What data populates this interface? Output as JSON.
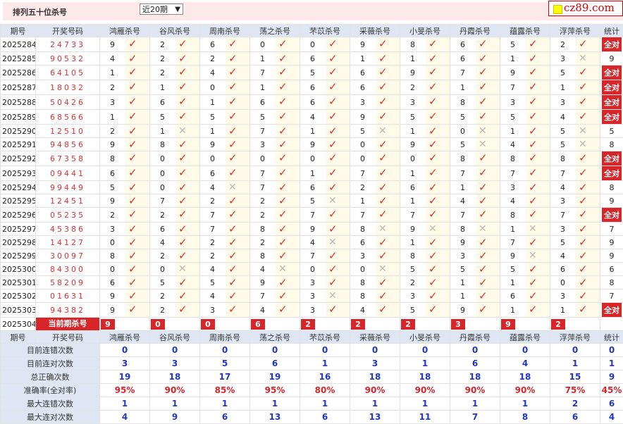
{
  "header": {
    "title": "排列五十位杀号",
    "period_select": "近20期",
    "logo_text": "cz89.com"
  },
  "columns": [
    "期号",
    "开奖号码",
    "鸿雁杀号",
    "谷风杀号",
    "周南杀号",
    "荡之杀号",
    "芣苡杀号",
    "采薇杀号",
    "小旻杀号",
    "丹霞杀号",
    "蕴露杀号",
    "浮萍杀号",
    "统计"
  ],
  "rows": [
    {
      "issue": "2025284",
      "num": "24733",
      "k": [
        "9",
        "2",
        "6",
        "0",
        "0",
        "9",
        "8",
        "6",
        "5",
        "2"
      ],
      "s": "全对"
    },
    {
      "issue": "2025285",
      "num": "90532",
      "k": [
        "4",
        "2",
        "2",
        "1",
        "6",
        "1",
        "1",
        "6",
        "1",
        "3"
      ],
      "s": "9"
    },
    {
      "issue": "2025286",
      "num": "64105",
      "k": [
        "1",
        "2",
        "4",
        "7",
        "5",
        "6",
        "9",
        "7",
        "9",
        "5"
      ],
      "s": "全对"
    },
    {
      "issue": "2025287",
      "num": "18032",
      "k": [
        "2",
        "1",
        "0",
        "1",
        "6",
        "6",
        "2",
        "1",
        "7",
        "1"
      ],
      "s": "全对"
    },
    {
      "issue": "2025288",
      "num": "50426",
      "k": [
        "3",
        "6",
        "1",
        "6",
        "6",
        "3",
        "3",
        "8",
        "3",
        "3"
      ],
      "s": "全对"
    },
    {
      "issue": "2025289",
      "num": "68566",
      "k": [
        "1",
        "5",
        "5",
        "5",
        "4",
        "9",
        "5",
        "5",
        "5",
        "4"
      ],
      "s": "全对"
    },
    {
      "issue": "2025290",
      "num": "12510",
      "k": [
        "2",
        "1",
        "1",
        "7",
        "1",
        "5",
        "1",
        "0",
        "1",
        "5"
      ],
      "s": "5"
    },
    {
      "issue": "2025291",
      "num": "94856",
      "k": [
        "9",
        "8",
        "9",
        "3",
        "9",
        "0",
        "9",
        "5",
        "4",
        "5"
      ],
      "s": "8"
    },
    {
      "issue": "2025292",
      "num": "67358",
      "k": [
        "8",
        "0",
        "0",
        "0",
        "0",
        "0",
        "0",
        "8",
        "8",
        "8"
      ],
      "s": "全对"
    },
    {
      "issue": "2025293",
      "num": "09441",
      "k": [
        "6",
        "0",
        "6",
        "7",
        "1",
        "7",
        "1",
        "7",
        "7",
        "7"
      ],
      "s": "全对"
    },
    {
      "issue": "2025294",
      "num": "99449",
      "k": [
        "5",
        "0",
        "4",
        "7",
        "6",
        "2",
        "6",
        "1",
        "3",
        "4"
      ],
      "s": "8"
    },
    {
      "issue": "2025295",
      "num": "12451",
      "k": [
        "9",
        "7",
        "2",
        "2",
        "5",
        "1",
        "1",
        "4",
        "4",
        "3"
      ],
      "s": "9"
    },
    {
      "issue": "2025296",
      "num": "05235",
      "k": [
        "2",
        "2",
        "7",
        "2",
        "7",
        "7",
        "7",
        "7",
        "8",
        "7"
      ],
      "s": "全对"
    },
    {
      "issue": "2025297",
      "num": "45386",
      "k": [
        "3",
        "6",
        "7",
        "8",
        "9",
        "8",
        "9",
        "8",
        "1",
        "3"
      ],
      "s": "7"
    },
    {
      "issue": "2025298",
      "num": "14127",
      "k": [
        "0",
        "4",
        "2",
        "2",
        "4",
        "6",
        "1",
        "9",
        "7",
        "5"
      ],
      "s": "9"
    },
    {
      "issue": "2025299",
      "num": "30097",
      "k": [
        "8",
        "2",
        "2",
        "8",
        "7",
        "3",
        "8",
        "3",
        "9",
        "4"
      ],
      "s": "9"
    },
    {
      "issue": "2025300",
      "num": "84300",
      "k": [
        "0",
        "0",
        "4",
        "4",
        "0",
        "0",
        "5",
        "5",
        "5",
        "6"
      ],
      "s": "6"
    },
    {
      "issue": "2025301",
      "num": "58209",
      "k": [
        "6",
        "5",
        "5",
        "9",
        "3",
        "8",
        "2",
        "1",
        "1",
        "0"
      ],
      "s": "8"
    },
    {
      "issue": "2025302",
      "num": "01631",
      "k": [
        "9",
        "2",
        "4",
        "7",
        "3",
        "8",
        "3",
        "1",
        "6",
        "3"
      ],
      "s": "7"
    },
    {
      "issue": "2025303",
      "num": "94382",
      "k": [
        "9",
        "2",
        "3",
        "4",
        "3",
        "4",
        "5",
        "9",
        "1",
        "1"
      ],
      "s": "全对"
    }
  ],
  "marks": [
    "1111111111",
    "1111111110",
    "1111111111",
    "1111111111",
    "1111111111",
    "1111111111",
    "1011101010",
    "1111111010",
    "1111111111",
    "1111111111",
    "1101111111",
    "1111011111",
    "1111111111",
    "1111100001",
    "1111011111",
    "1111111101",
    "1010101111",
    "1111111111",
    "1111011111",
    "1111111111"
  ],
  "current": {
    "issue": "2025304",
    "label": "当前期杀号",
    "k": [
      "9",
      "0",
      "0",
      "6",
      "2",
      "2",
      "2",
      "3",
      "9",
      "2"
    ]
  },
  "stats": [
    {
      "label": "目前连错次数",
      "vals": [
        "0",
        "0",
        "0",
        "0",
        "0",
        "0",
        "0",
        "0",
        "0",
        "0",
        "0"
      ],
      "red": false
    },
    {
      "label": "目前连对次数",
      "vals": [
        "3",
        "3",
        "5",
        "6",
        "1",
        "3",
        "1",
        "6",
        "4",
        "1",
        "1"
      ],
      "red": false
    },
    {
      "label": "总正确次数",
      "vals": [
        "19",
        "18",
        "17",
        "19",
        "16",
        "18",
        "18",
        "18",
        "18",
        "15",
        "9"
      ],
      "red": false
    },
    {
      "label": "准确率(全对率)",
      "vals": [
        "95%",
        "90%",
        "85%",
        "95%",
        "80%",
        "90%",
        "90%",
        "90%",
        "90%",
        "75%",
        "45%"
      ],
      "red": true
    },
    {
      "label": "最大连错次数",
      "vals": [
        "1",
        "1",
        "1",
        "1",
        "1",
        "1",
        "1",
        "1",
        "1",
        "2",
        "6"
      ],
      "red": false
    },
    {
      "label": "最大连对次数",
      "vals": [
        "4",
        "9",
        "6",
        "13",
        "6",
        "13",
        "11",
        "7",
        "8",
        "6",
        "4"
      ],
      "red": false
    }
  ],
  "icons": {
    "check": "check-icon",
    "cross": "cross-icon"
  }
}
